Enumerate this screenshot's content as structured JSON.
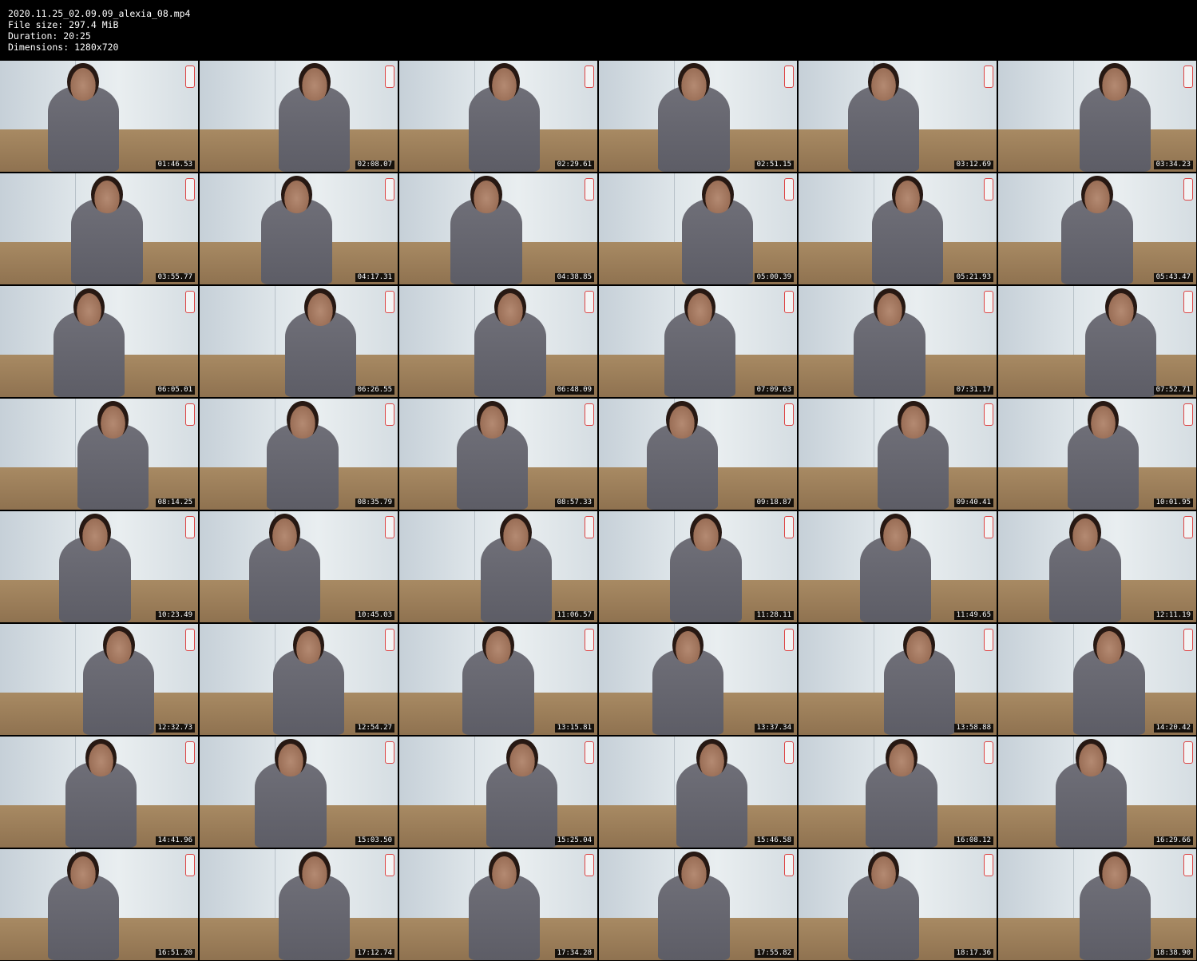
{
  "header": {
    "filename": "2020.11.25_02.09.09_alexia_08.mp4",
    "file_size": "File size: 297.4 MiB",
    "duration": "Duration: 20:25",
    "dimensions": "Dimensions: 1280x720"
  },
  "thumbnails": [
    "01:46.53",
    "02:08.07",
    "02:29.61",
    "02:51.15",
    "03:12.69",
    "03:34.23",
    "03:55.77",
    "04:17.31",
    "04:38.85",
    "05:00.39",
    "05:21.93",
    "05:43.47",
    "06:05.01",
    "06:26.55",
    "06:48.09",
    "07:09.63",
    "07:31.17",
    "07:52.71",
    "08:14.25",
    "08:35.79",
    "08:57.33",
    "09:18.87",
    "09:40.41",
    "10:01.95",
    "10:23.49",
    "10:45.03",
    "11:06.57",
    "11:28.11",
    "11:49.65",
    "12:11.19",
    "12:32.73",
    "12:54.27",
    "13:15.81",
    "13:37.34",
    "13:58.88",
    "14:20.42",
    "14:41.96",
    "15:03.50",
    "15:25.04",
    "15:46.58",
    "16:08.12",
    "16:29.66",
    "16:51.20",
    "17:12.74",
    "17:34.28",
    "17:55.82",
    "18:17.36",
    "18:38.90"
  ]
}
